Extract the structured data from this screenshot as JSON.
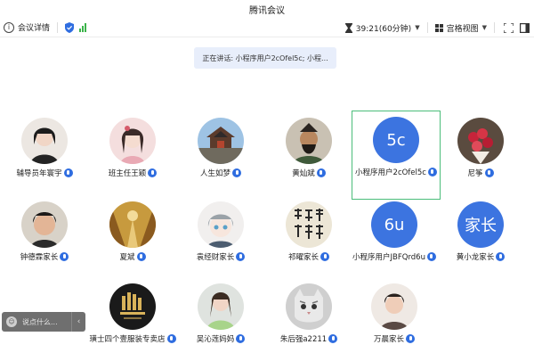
{
  "window": {
    "title": "腾讯会议"
  },
  "toolbar": {
    "info_label": "会议详情",
    "timer": "39:21(60分钟)",
    "view_label": "宫格视图"
  },
  "speaking_banner": "正在讲话: 小程序用户2cOfel5c; 小程...",
  "participants": [
    {
      "name": "辅导员年寰宇",
      "avatar": "photo"
    },
    {
      "name": "班主任王颖",
      "avatar": "photo"
    },
    {
      "name": "人生如梦",
      "avatar": "photo"
    },
    {
      "name": "黄灿斌",
      "avatar": "photo"
    },
    {
      "name": "小程序用户2cOfel5c",
      "avatar": "letter",
      "avatar_text": "5c",
      "selected": true
    },
    {
      "name": "尼筝",
      "avatar": "photo"
    },
    {
      "name": "钟德霖家长",
      "avatar": "photo"
    },
    {
      "name": "夏斌",
      "avatar": "photo"
    },
    {
      "name": "袁经财家长",
      "avatar": "photo"
    },
    {
      "name": "祁曜家长",
      "avatar": "photo"
    },
    {
      "name": "小程序用户JBFQrd6u",
      "avatar": "letter",
      "avatar_text": "6u"
    },
    {
      "name": "黄小龙家长",
      "avatar": "letter",
      "avatar_text": "家长"
    },
    {
      "name": "璜士四个壹服装专卖店",
      "avatar": "photo"
    },
    {
      "name": "吴沁莲妈妈",
      "avatar": "photo"
    },
    {
      "name": "朱后强a2211",
      "avatar": "photo"
    },
    {
      "name": "万晨家长",
      "avatar": "photo"
    }
  ],
  "chat": {
    "placeholder": "说点什么..."
  },
  "colors": {
    "accent": "#3c74e0",
    "selected_border": "#4bbd7a",
    "signal": "#3bb34a"
  }
}
